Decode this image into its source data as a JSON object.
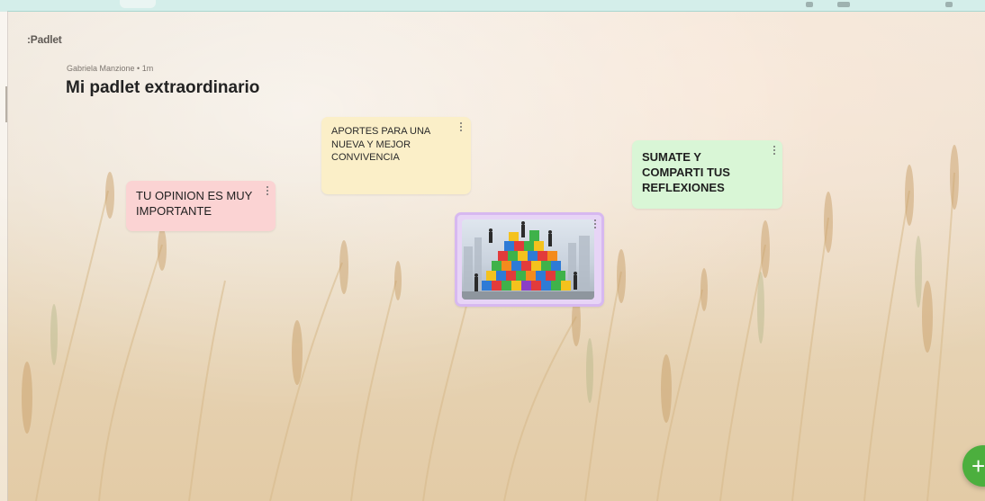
{
  "app": {
    "logo": ":Padlet"
  },
  "board": {
    "meta": "Gabriela Manzione • 1m",
    "title": "Mi padlet extraordinario"
  },
  "posts": [
    {
      "text": "APORTES PARA UNA NUEVA Y MEJOR CONVIVENCIA",
      "color": "#fbefc8"
    },
    {
      "text": "TU OPINION ES MUY IMPORTANTE",
      "color": "#fbd3d3"
    },
    {
      "text": "SUMATE Y COMPARTI TUS REFLEXIONES",
      "color": "#d9f6d6"
    },
    {
      "text": "",
      "color": "#e7d4f6",
      "attachment": "puzzle-teamwork-image"
    }
  ],
  "fab": {
    "icon": "plus-icon",
    "label": "+",
    "color": "#4caf3e"
  }
}
